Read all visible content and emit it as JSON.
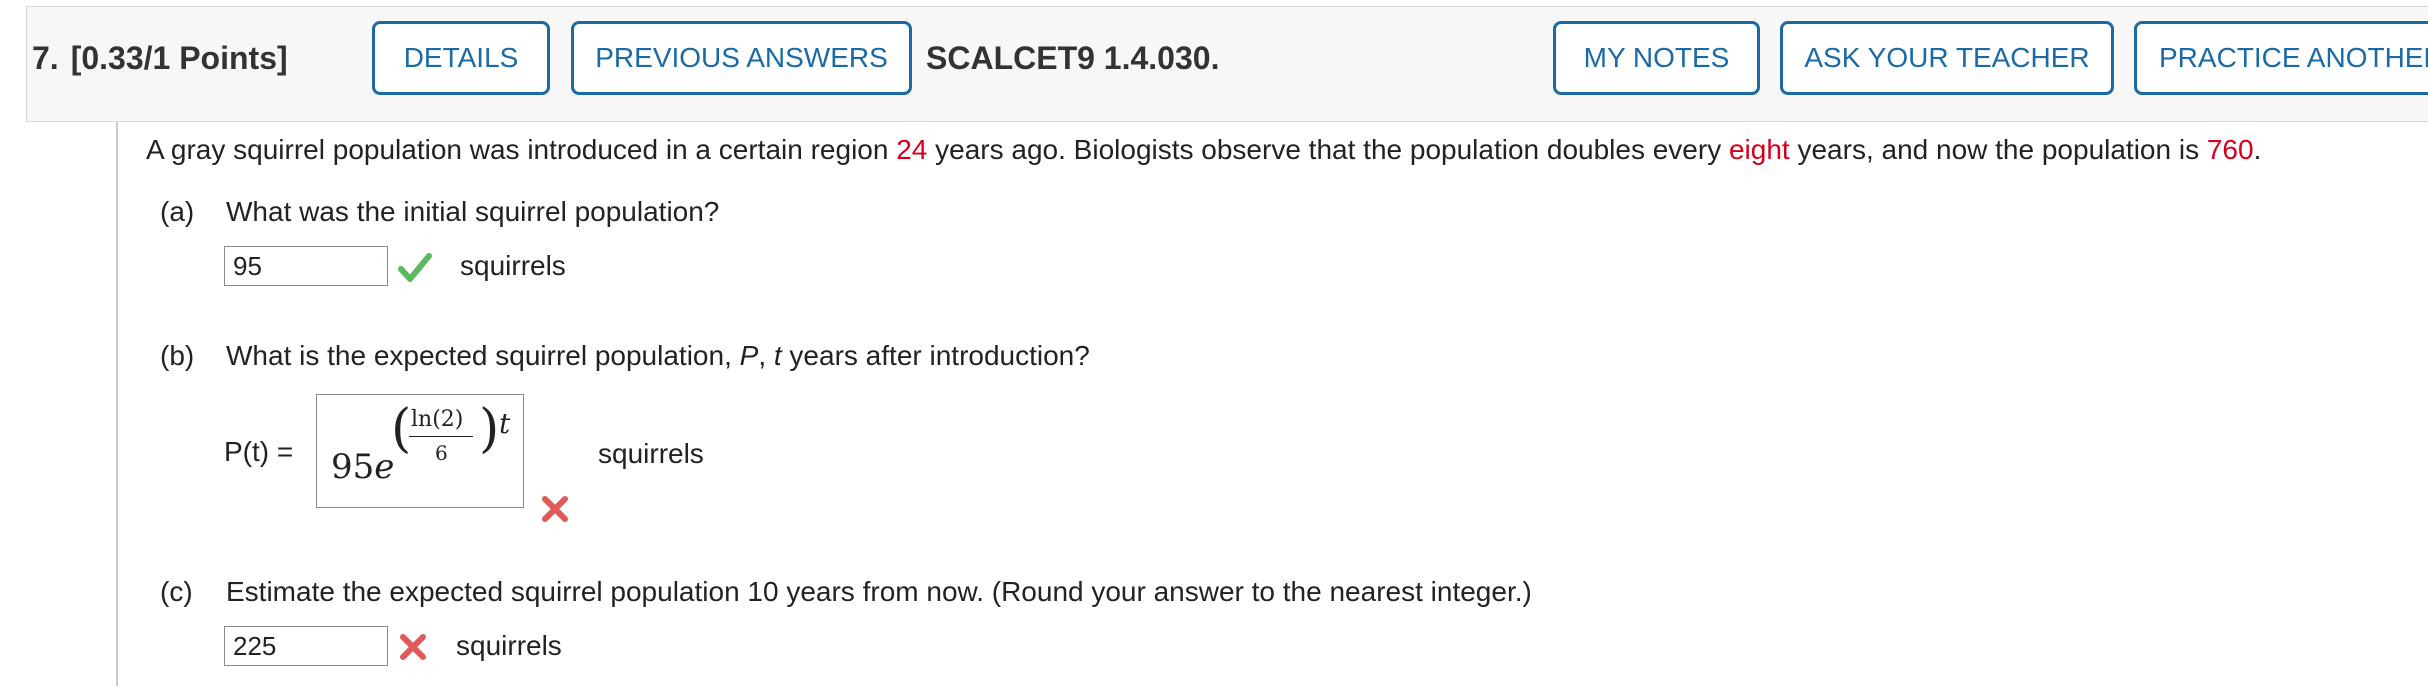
{
  "header": {
    "question_number": "7.",
    "points": "[0.33/1 Points]",
    "buttons": {
      "details": "DETAILS",
      "previous_answers": "PREVIOUS ANSWERS",
      "my_notes": "MY NOTES",
      "ask_your_teacher": "ASK YOUR TEACHER",
      "practice_another": "PRACTICE ANOTHER"
    },
    "problem_code": "SCALCET9 1.4.030."
  },
  "problem": {
    "text_1": "A gray squirrel population was introduced in a certain region ",
    "years_ago": "24",
    "text_2": " years ago. Biologists observe that the population doubles every ",
    "doubling": "eight",
    "text_3": " years, and now the population is ",
    "current_population": "760",
    "text_4": "."
  },
  "part_a": {
    "letter": "(a)",
    "question": "What was the initial squirrel population?",
    "answer": "95",
    "unit": "squirrels",
    "status": "correct"
  },
  "part_b": {
    "letter": "(b)",
    "question_1": "What is the expected squirrel population, ",
    "var_p": "P",
    "question_2": ", ",
    "var_t": "t",
    "question_3": " years after introduction?",
    "function_label": "P(t)  =",
    "answer": {
      "coefficient": "95",
      "base": "e",
      "numerator": "ln(2)",
      "denominator": "6",
      "variable": "t"
    },
    "unit": "squirrels",
    "status": "incorrect"
  },
  "part_c": {
    "letter": "(c)",
    "question": "Estimate the expected squirrel population 10 years from now. (Round your answer to the nearest integer.)",
    "answer": "225",
    "unit": "squirrels",
    "status": "incorrect"
  },
  "colors": {
    "button_blue": "#1b6aa5",
    "highlight_red": "#d6001c",
    "check_green": "#5cb85c",
    "cross_red": "#e05a5a"
  }
}
